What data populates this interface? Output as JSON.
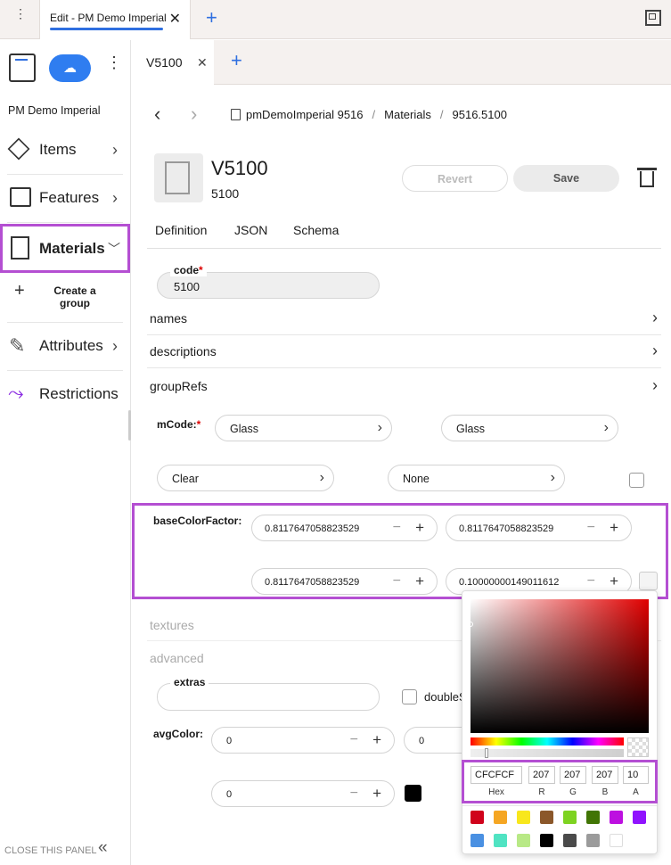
{
  "window": {
    "tab_title": "Edit - PM Demo Imperial",
    "add_tab": "+"
  },
  "sidebar": {
    "project": "PM Demo Imperial",
    "items": [
      {
        "label": "Items"
      },
      {
        "label": "Features"
      },
      {
        "label": "Materials"
      },
      {
        "label": "Attributes"
      },
      {
        "label": "Restrictions"
      }
    ],
    "create_group": "Create a group",
    "close_panel": "CLOSE THIS PANEL"
  },
  "editor": {
    "tab": "V5100",
    "breadcrumb": [
      "pmDemoImperial 9516",
      "Materials",
      "9516.5100"
    ],
    "title": "V5100",
    "subtitle": "5100",
    "revert": "Revert",
    "save": "Save",
    "subtabs": [
      "Definition",
      "JSON",
      "Schema"
    ]
  },
  "form": {
    "code_label": "code",
    "code_value": "5100",
    "rows": [
      "names",
      "descriptions",
      "groupRefs"
    ],
    "mcode_label": "mCode:",
    "mcode_values": [
      "Glass",
      "Glass",
      "Clear",
      "None"
    ],
    "base_label": "baseColorFactor:",
    "base_values": [
      "0.8117647058823529",
      "0.8117647058823529",
      "0.8117647058823529",
      "0.10000000149011612"
    ],
    "textures": "textures",
    "advanced": "advanced",
    "extras": "extras",
    "double_sided": "doubleS",
    "avg_label": "avgColor:",
    "avg_values": [
      "0",
      "0",
      "0"
    ]
  },
  "picker": {
    "hex": "CFCFCF",
    "r": "207",
    "g": "207",
    "b": "207",
    "a": "10",
    "labels": [
      "Hex",
      "R",
      "G",
      "B",
      "A"
    ],
    "swatches": [
      "#d0021b",
      "#f5a623",
      "#f8e71c",
      "#8b572a",
      "#7ed321",
      "#417505",
      "#bd10e0",
      "#9013fe",
      "#4a90e2",
      "#50e3c2",
      "#b8e986",
      "#000000",
      "#4a4a4a",
      "#9b9b9b",
      "#ffffff"
    ]
  }
}
